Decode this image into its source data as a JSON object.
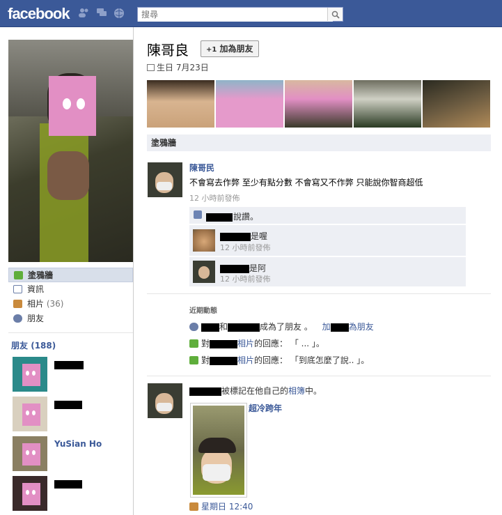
{
  "topbar": {
    "logo": "facebook",
    "search_placeholder": "搜尋"
  },
  "profile": {
    "name": "陳哥良",
    "add_friend_label": "加為朋友",
    "birthday": "生日 7月23日"
  },
  "nav": {
    "items": [
      {
        "label": "塗鴉牆",
        "count": ""
      },
      {
        "label": "資訊",
        "count": ""
      },
      {
        "label": "相片",
        "count": "(36)"
      },
      {
        "label": "朋友",
        "count": ""
      }
    ]
  },
  "friends": {
    "title": "朋友",
    "count": "(188)",
    "list": [
      {
        "name": ""
      },
      {
        "name": ""
      },
      {
        "name": "YuSian Ho"
      },
      {
        "name": ""
      }
    ]
  },
  "wall": {
    "header": "塗鴉牆",
    "post": {
      "author": "陳哥民",
      "text": "不會寫去作弊 至少有點分數 不會寫又不作弊 只能說你智商超低",
      "time": "12 小時前發佈",
      "like_text": "說讚。",
      "comments": [
        {
          "text": "是喔",
          "time": "12 小時前發佈"
        },
        {
          "text": "是阿",
          "time": "12 小時前發佈"
        }
      ]
    },
    "recent": {
      "title": "近期動態",
      "items": [
        {
          "text_a": "和",
          "text_b": "成為了朋友 。",
          "link": "加",
          "link2": "為朋友"
        },
        {
          "text_a": "對",
          "link": "相片",
          "text_b": "的回應： 「 ... 」。"
        },
        {
          "text_a": "對",
          "link": "相片",
          "text_b": "的回應： 「到底怎麼了說.. 」。"
        }
      ]
    },
    "album_post": {
      "text": "被標記在他自己的",
      "link": "相簿",
      "suffix": "中。",
      "album_title": "超冷跨年",
      "time": "星期日 12:40"
    }
  },
  "colors": {
    "brand": "#3b5998",
    "highlight": "#d8dfea",
    "box": "#edeff4"
  }
}
